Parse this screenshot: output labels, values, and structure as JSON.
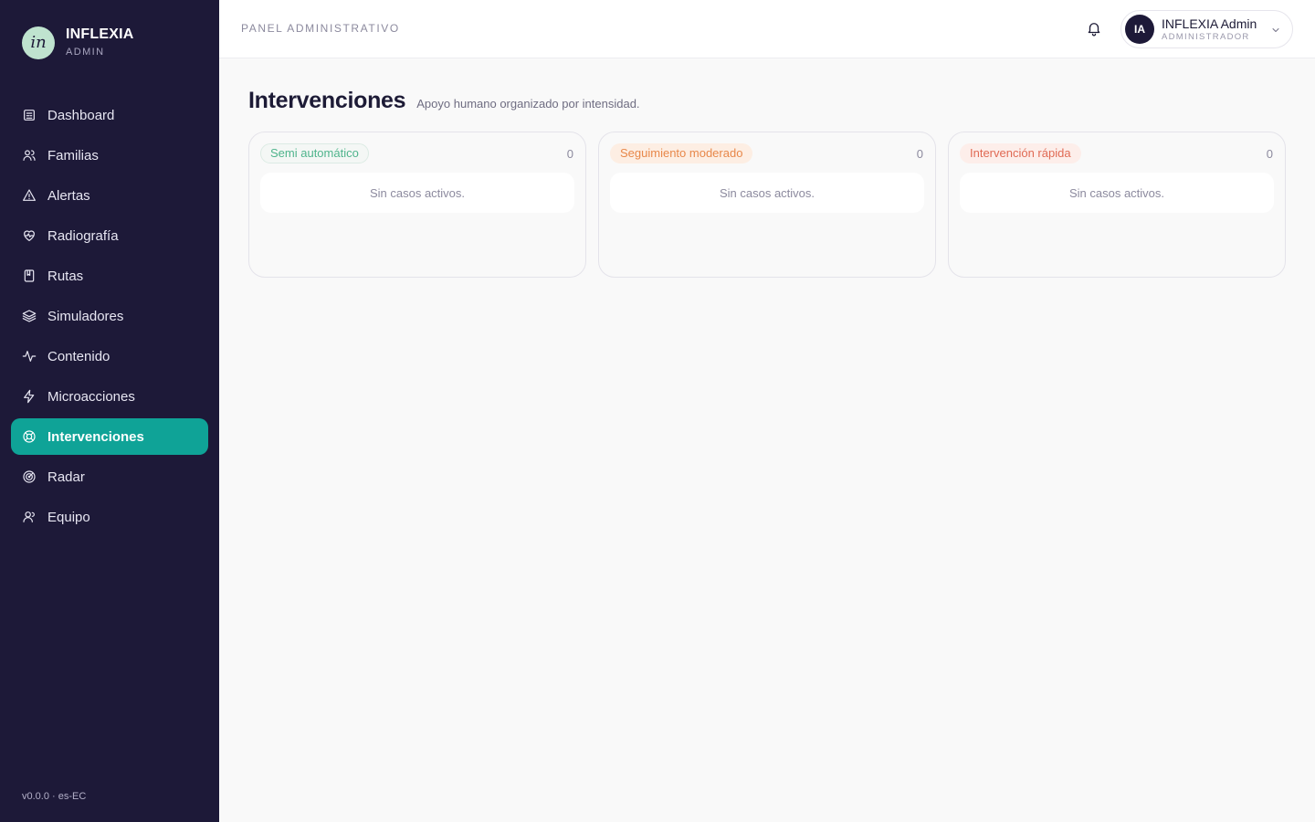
{
  "brand": {
    "logo_text": "in",
    "name": "INFLEXIA",
    "subtitle": "ADMIN"
  },
  "sidebar": {
    "items": [
      {
        "label": "Dashboard",
        "icon": "dashboard-icon"
      },
      {
        "label": "Familias",
        "icon": "users-icon"
      },
      {
        "label": "Alertas",
        "icon": "alert-triangle-icon"
      },
      {
        "label": "Radiografía",
        "icon": "heart-pulse-icon"
      },
      {
        "label": "Rutas",
        "icon": "book-icon"
      },
      {
        "label": "Simuladores",
        "icon": "layers-icon"
      },
      {
        "label": "Contenido",
        "icon": "activity-icon"
      },
      {
        "label": "Microacciones",
        "icon": "zap-icon"
      },
      {
        "label": "Intervenciones",
        "icon": "lifebuoy-icon",
        "active": true
      },
      {
        "label": "Radar",
        "icon": "radar-icon"
      },
      {
        "label": "Equipo",
        "icon": "team-icon"
      }
    ],
    "version": "v0.0.0 · es-EC"
  },
  "header": {
    "section_label": "PANEL ADMINISTRATIVO",
    "user": {
      "initials": "IA",
      "name": "INFLEXIA Admin",
      "role": "ADMINISTRADOR"
    }
  },
  "main": {
    "title": "Intervenciones",
    "subtitle": "Apoyo humano organizado por intensidad.",
    "columns": [
      {
        "label": "Semi automático",
        "count": "0",
        "empty_text": "Sin casos activos.",
        "color": "#4fb48c"
      },
      {
        "label": "Seguimiento moderado",
        "count": "0",
        "empty_text": "Sin casos activos.",
        "color": "#e8884a"
      },
      {
        "label": "Intervención rápida",
        "count": "0",
        "empty_text": "Sin casos activos.",
        "color": "#e06a54"
      }
    ]
  },
  "colors": {
    "sidebar_bg": "#1d1938",
    "accent": "#0fa397",
    "logo_bg": "#bfe3cf"
  }
}
